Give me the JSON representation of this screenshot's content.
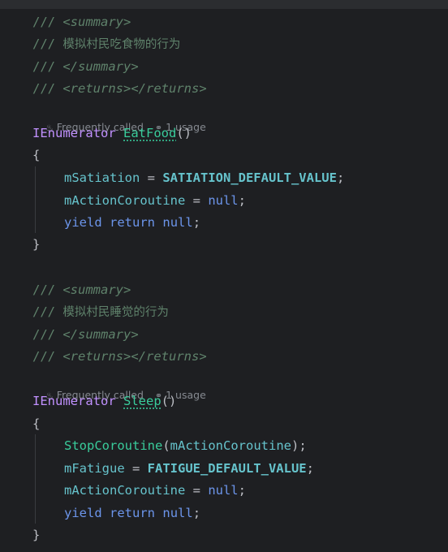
{
  "block1": {
    "doc_open": "<summary>",
    "doc_summary": "模拟村民吃食物的行为",
    "doc_close": "</summary>",
    "doc_returns_open": "<returns>",
    "doc_returns_close": "</returns>",
    "hint_frequency": "Frequently called",
    "hint_usages": "1 usage",
    "return_type": "IEnumerator",
    "method_name": "EatFood",
    "params": "()",
    "open_brace": "{",
    "close_brace": "}",
    "stmt1_field": "mSatiation",
    "stmt1_op": " = ",
    "stmt1_value": "SATIATION_DEFAULT_VALUE",
    "stmt2_field": "mActionCoroutine",
    "stmt2_op": " = ",
    "stmt2_value": "null",
    "stmt3_kw1": "yield",
    "stmt3_kw2": "return",
    "stmt3_value": "null"
  },
  "block2": {
    "doc_open": "<summary>",
    "doc_summary": "模拟村民睡觉的行为",
    "doc_close": "</summary>",
    "doc_returns_open": "<returns>",
    "doc_returns_close": "</returns>",
    "hint_frequency": "Frequently called",
    "hint_usages": "1 usage",
    "return_type": "IEnumerator",
    "method_name": "Sleep",
    "params": "()",
    "open_brace": "{",
    "close_brace": "}",
    "stmt1_call": "StopCoroutine",
    "stmt1_arg": "mActionCoroutine",
    "stmt2_field": "mFatigue",
    "stmt2_op": " = ",
    "stmt2_value": "FATIGUE_DEFAULT_VALUE",
    "stmt3_field": "mActionCoroutine",
    "stmt3_op": " = ",
    "stmt3_value": "null",
    "stmt4_kw1": "yield",
    "stmt4_kw2": "return",
    "stmt4_value": "null"
  },
  "common": {
    "doc_prefix": "/// ",
    "semicolon": ";",
    "paren_open": "(",
    "paren_close": ")"
  },
  "icons": {
    "frequency": "flame-icon",
    "usages": "link-icon"
  },
  "colors": {
    "background": "#1e1f22",
    "comment": "#5f826b",
    "keyword": "#6c95eb",
    "type": "#c191ff",
    "method": "#39cc9b",
    "field": "#66c3cc",
    "inlay_hint": "#868a91",
    "text": "#bcbec4"
  }
}
